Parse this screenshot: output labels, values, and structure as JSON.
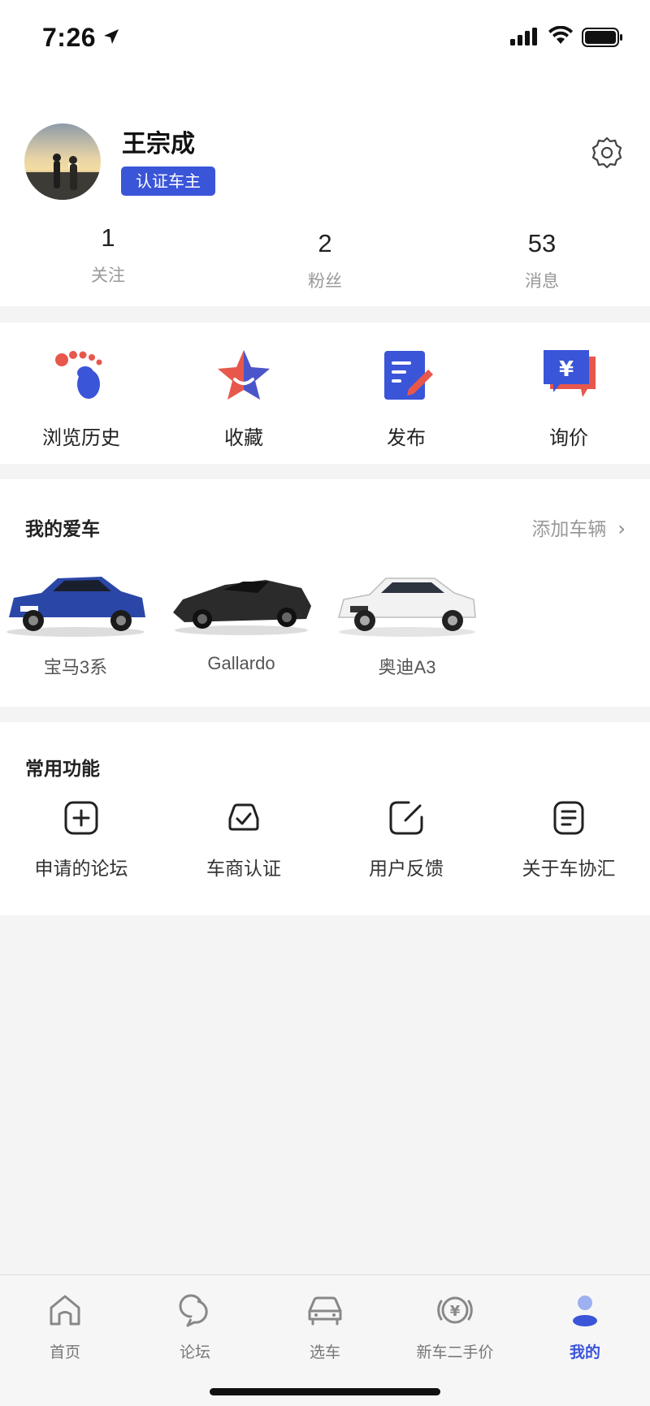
{
  "status_bar": {
    "time": "7:26"
  },
  "profile": {
    "name": "王宗成",
    "badge": "认证车主",
    "stats": [
      {
        "value": "1",
        "label": "关注"
      },
      {
        "value": "2",
        "label": "粉丝"
      },
      {
        "value": "53",
        "label": "消息"
      }
    ]
  },
  "quick_actions": [
    {
      "label": "浏览历史",
      "icon": "footprint-icon"
    },
    {
      "label": "收藏",
      "icon": "star-icon"
    },
    {
      "label": "发布",
      "icon": "edit-document-icon"
    },
    {
      "label": "询价",
      "icon": "price-inquiry-icon"
    }
  ],
  "my_cars": {
    "title": "我的爱车",
    "add_label": "添加车辆",
    "cars": [
      {
        "name": "宝马3系",
        "color": "#2a47a8"
      },
      {
        "name": "Gallardo",
        "color": "#2b2b2b"
      },
      {
        "name": "奥迪A3",
        "color": "#f2f2f2"
      }
    ]
  },
  "common_functions": {
    "title": "常用功能",
    "items": [
      {
        "label": "申请的论坛",
        "icon": "plus-square-icon"
      },
      {
        "label": "车商认证",
        "icon": "car-check-icon"
      },
      {
        "label": "用户反馈",
        "icon": "feedback-edit-icon"
      },
      {
        "label": "关于车协汇",
        "icon": "info-document-icon"
      }
    ]
  },
  "tab_bar": {
    "active_color": "#3a55d8",
    "tabs": [
      {
        "label": "首页",
        "icon": "home-icon",
        "active": false
      },
      {
        "label": "论坛",
        "icon": "chat-bubbles-icon",
        "active": false
      },
      {
        "label": "选车",
        "icon": "car-icon",
        "active": false
      },
      {
        "label": "新车二手价",
        "icon": "yuan-coin-icon",
        "active": false
      },
      {
        "label": "我的",
        "icon": "user-icon",
        "active": true
      }
    ]
  }
}
